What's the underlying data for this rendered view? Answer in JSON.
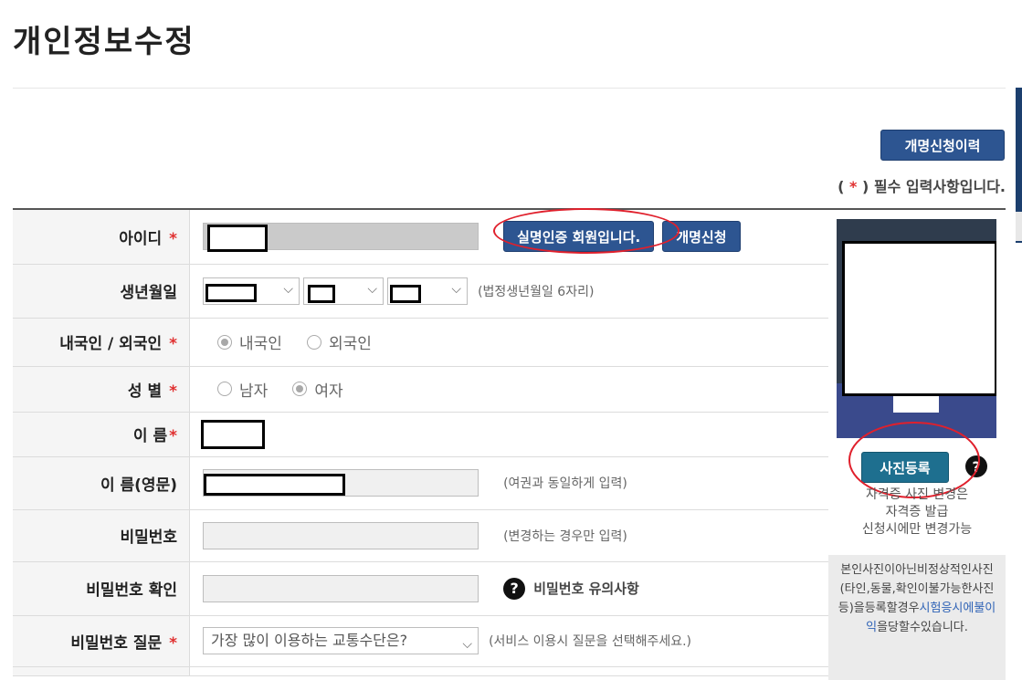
{
  "page": {
    "title": "개인정보수정",
    "required_note_open": "(",
    "required_note_star": "*",
    "required_note_close": ")",
    "required_note_text": "필수 입력사항입니다."
  },
  "buttons": {
    "rename_history": "개명신청이력",
    "verified_member": "실명인증 회원입니다.",
    "rename_request": "개명신청",
    "photo_register": "사진등록"
  },
  "form": {
    "id": {
      "label": "아이디",
      "required": "*"
    },
    "birthdate": {
      "label": "생년월일",
      "hint": "(법정생년월일 6자리)"
    },
    "nationality": {
      "label": "내국인 / 외국인",
      "required": "*",
      "options": [
        "내국인",
        "외국인"
      ],
      "selected": "내국인"
    },
    "gender": {
      "label": "성 별",
      "required": "*",
      "options": [
        "남자",
        "여자"
      ],
      "selected": "여자"
    },
    "name": {
      "label": "이 름",
      "required": "*"
    },
    "name_en": {
      "label": "이 름(영문)",
      "hint": "(여권과 동일하게 입력)"
    },
    "password": {
      "label": "비밀번호",
      "hint": "(변경하는 경우만 입력)"
    },
    "password_confirm": {
      "label": "비밀번호 확인",
      "help_label": "비밀번호 유의사항"
    },
    "password_question": {
      "label": "비밀번호 질문",
      "required": "*",
      "selected": "가장 많이 이용하는 교통수단은?",
      "hint": "(서비스 이용시 질문을 선택해주세요.)"
    }
  },
  "photo": {
    "note_line1": "자격증 사진 변경은",
    "note_line2": "자격증 발급",
    "note_line3": "신청시에만 변경가능",
    "warning_pre": "본인사진이아닌비정상적인사진(타인,동물,확인이불가능한사진등)을등록할경우",
    "warning_link": "시험응시에불이익",
    "warning_post": "을당할수있습니다."
  },
  "colors": {
    "primary_button": "#2d5591",
    "photo_button": "#1e6f8f",
    "required": "#e03030",
    "annotation": "#e0202c"
  }
}
